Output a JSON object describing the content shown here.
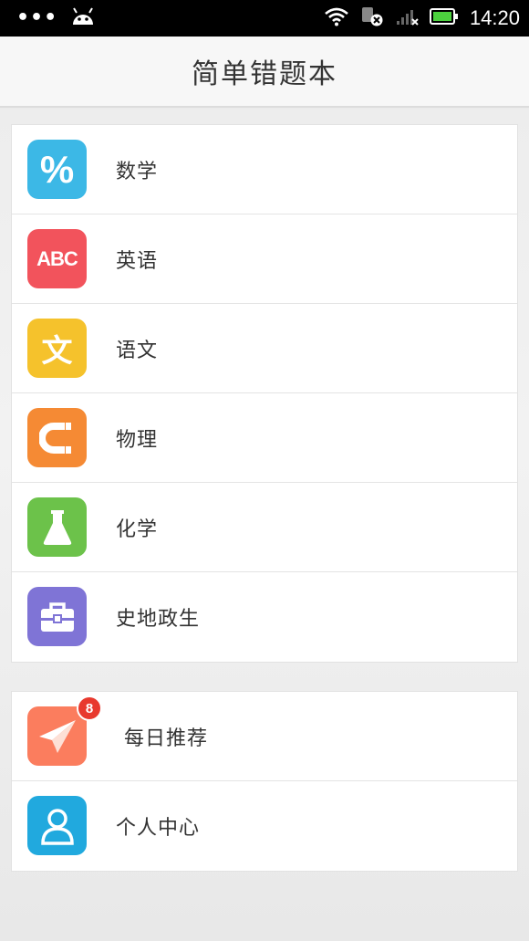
{
  "status_bar": {
    "dots": "•••",
    "time": "14:20"
  },
  "header": {
    "title": "简单错题本"
  },
  "subjects": [
    {
      "label": "数学",
      "icon": "percent-icon",
      "color": "#3cb8e6"
    },
    {
      "label": "英语",
      "icon": "abc-icon",
      "color": "#f2535c"
    },
    {
      "label": "语文",
      "icon": "wen-character-icon",
      "color": "#f5c22c"
    },
    {
      "label": "物理",
      "icon": "magnet-icon",
      "color": "#f58a34"
    },
    {
      "label": "化学",
      "icon": "flask-icon",
      "color": "#6cc24a"
    },
    {
      "label": "史地政生",
      "icon": "briefcase-icon",
      "color": "#7f74d6"
    }
  ],
  "extras": [
    {
      "label": "每日推荐",
      "icon": "paper-plane-icon",
      "color": "#fb7d5e",
      "badge": "8"
    },
    {
      "label": "个人中心",
      "icon": "user-icon",
      "color": "#21a9de"
    }
  ],
  "icon_text": {
    "percent": "%",
    "abc": "ABC",
    "wen": "文"
  }
}
